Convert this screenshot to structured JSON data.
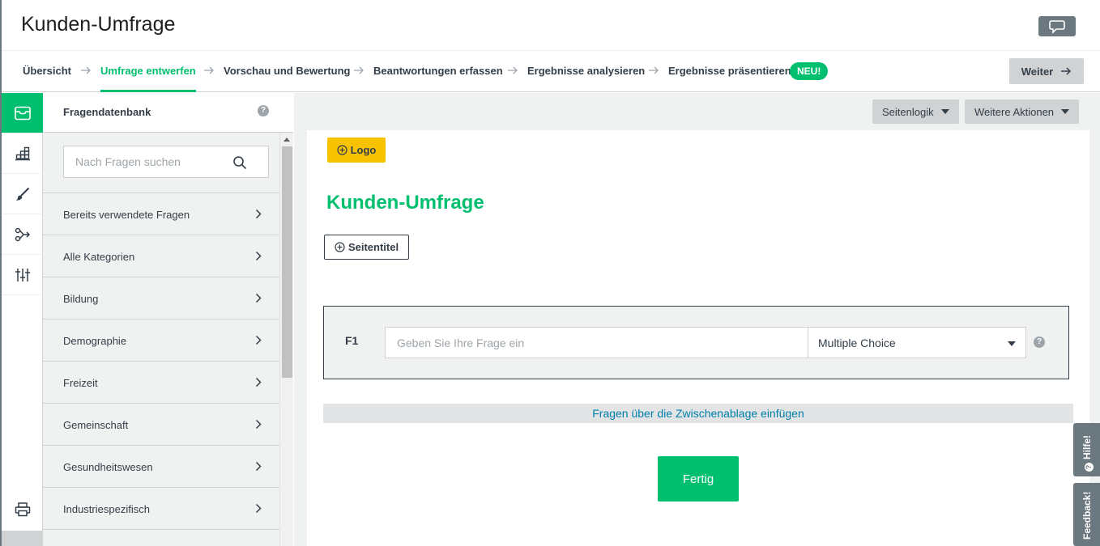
{
  "app": {
    "title": "Kunden-Umfrage"
  },
  "steps": [
    {
      "label": "Übersicht"
    },
    {
      "label": "Umfrage entwerfen"
    },
    {
      "label": "Vorschau und Bewertung"
    },
    {
      "label": "Beantwortungen erfassen"
    },
    {
      "label": "Ergebnisse analysieren"
    },
    {
      "label": "Ergebnisse präsentieren"
    }
  ],
  "active_step": "Umfrage entwerfen",
  "new_badge": "NEU!",
  "next_button": "Weiter",
  "rail": {
    "items": [
      "question-bank-icon",
      "builder-icon",
      "design-icon",
      "logic-icon",
      "options-icon"
    ],
    "bottom": "print-icon"
  },
  "bank": {
    "title": "Fragendatenbank",
    "help": "?",
    "search_placeholder": "Nach Fragen suchen",
    "categories": [
      "Bereits verwendete Fragen",
      "Alle Kategorien",
      "Bildung",
      "Demographie",
      "Freizeit",
      "Gemeinschaft",
      "Gesundheitswesen",
      "Industriespezifisch"
    ]
  },
  "toolbar": {
    "page_logic": "Seitenlogik",
    "more_actions": "Weitere Aktionen"
  },
  "canvas": {
    "logo_button": "Logo",
    "survey_title": "Kunden-Umfrage",
    "page_title_button": "Seitentitel",
    "question": {
      "number": "F1",
      "placeholder": "Geben Sie Ihre Frage ein",
      "type": "Multiple Choice",
      "help": "?"
    },
    "paste_link": "Fragen über die Zwischenablage einfügen",
    "done_button": "Fertig"
  },
  "side_tabs": {
    "help": "Hilfe!",
    "feedback": "Feedback!"
  },
  "colors": {
    "brand": "#00bf6f",
    "logo_button": "#f7c200",
    "link": "#007faa",
    "dark": "#333e48",
    "chrome": "#6b787f"
  }
}
